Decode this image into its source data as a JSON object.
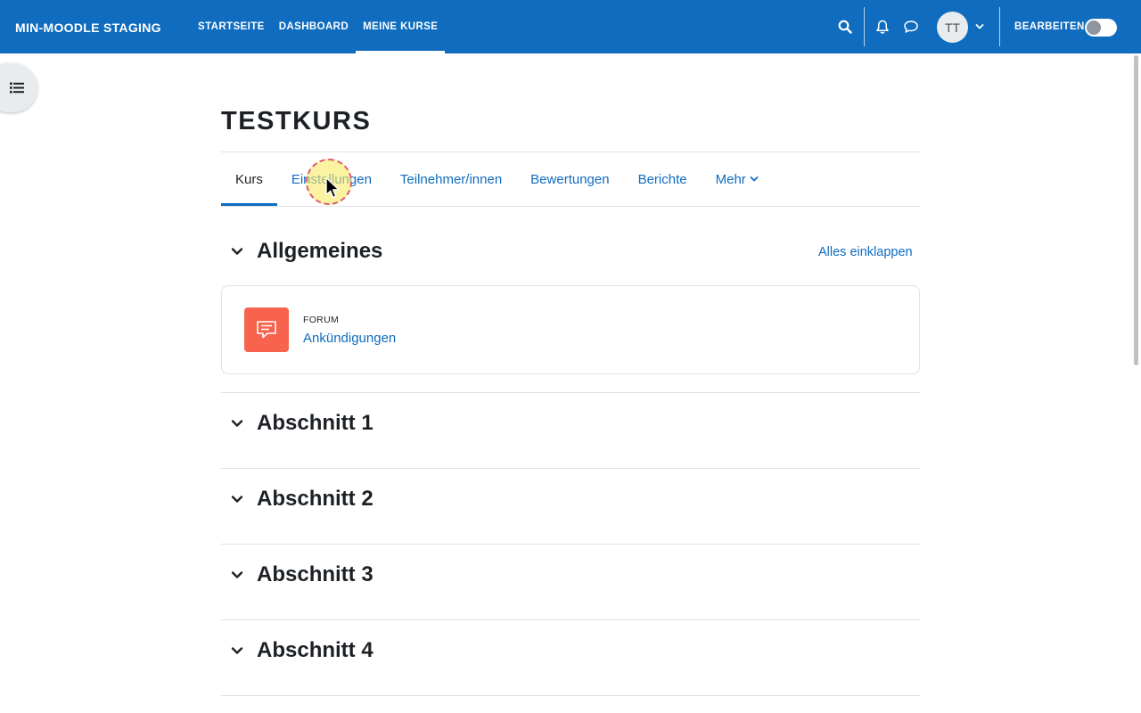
{
  "header": {
    "brand": "MIN-MOODLE STAGING",
    "nav": [
      {
        "label": "STARTSEITE"
      },
      {
        "label": "DASHBOARD"
      },
      {
        "label": "MEINE KURSE"
      }
    ],
    "avatar_initials": "TT",
    "edit_mode_label": "BEARBEITEN",
    "edit_mode_on": false
  },
  "icons": {
    "search": "search-icon",
    "notifications": "bell-icon",
    "messages": "chat-bubble-icon",
    "user_menu": "chevron-down-icon",
    "course_index": "list-icon",
    "section_toggle": "chevron-down-icon",
    "forum": "forum-icon"
  },
  "colors": {
    "brand_blue": "#0f6cbf",
    "forum_orange": "#f7634d",
    "text": "#1d2125",
    "divider": "#dee2e6"
  },
  "course": {
    "title": "TESTKURS",
    "tabs": [
      {
        "label": "Kurs"
      },
      {
        "label": "Einstellungen"
      },
      {
        "label": "Teilnehmer/innen"
      },
      {
        "label": "Bewertungen"
      },
      {
        "label": "Berichte"
      },
      {
        "label": "Mehr"
      }
    ],
    "collapse_all_label": "Alles einklappen",
    "sections": [
      {
        "title": "Allgemeines",
        "activities": [
          {
            "type": "FORUM",
            "name": "Ankündigungen"
          }
        ]
      },
      {
        "title": "Abschnitt 1"
      },
      {
        "title": "Abschnitt 2"
      },
      {
        "title": "Abschnitt 3"
      },
      {
        "title": "Abschnitt 4"
      }
    ]
  }
}
